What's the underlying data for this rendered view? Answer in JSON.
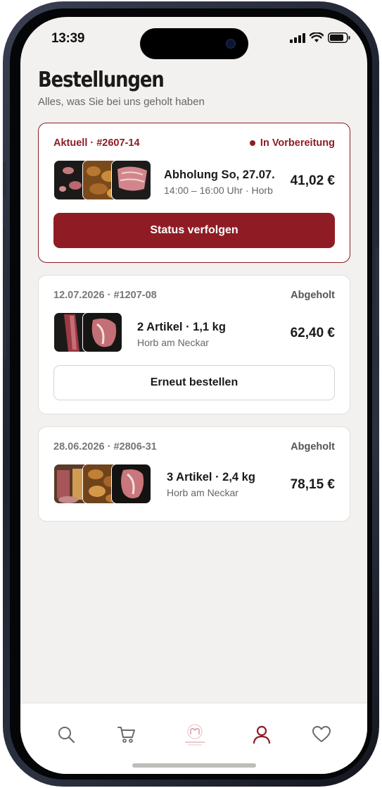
{
  "status_bar": {
    "time": "13:39"
  },
  "header": {
    "title": "Bestellungen",
    "subtitle": "Alles, was Sie bei uns geholt haben"
  },
  "orders": [
    {
      "ref": "Aktuell · #2607-14",
      "status": "In Vorbereitung",
      "main": "Abholung So, 27.07.",
      "sub": "14:00 – 16:00 Uhr · Horb",
      "price": "41,02 €",
      "action": "Status verfolgen"
    },
    {
      "ref": "12.07.2026 · #1207-08",
      "status": "Abgeholt",
      "main": "2 Artikel · 1,1 kg",
      "sub": "Horb am Neckar",
      "price": "62,40 €",
      "action": "Erneut bestellen"
    },
    {
      "ref": "28.06.2026 · #2806-31",
      "status": "Abgeholt",
      "main": "3 Artikel · 2,4 kg",
      "sub": "Horb am Neckar",
      "price": "78,15 €"
    }
  ],
  "tabbar": {
    "items": [
      {
        "icon": "search-icon"
      },
      {
        "icon": "cart-icon"
      },
      {
        "icon": "brand-logo"
      },
      {
        "icon": "profile-icon",
        "active": true
      },
      {
        "icon": "heart-icon"
      }
    ]
  },
  "colors": {
    "accent": "#8f1c24",
    "background": "#f2f1ef",
    "card": "#ffffff",
    "muted_text": "#666666"
  }
}
